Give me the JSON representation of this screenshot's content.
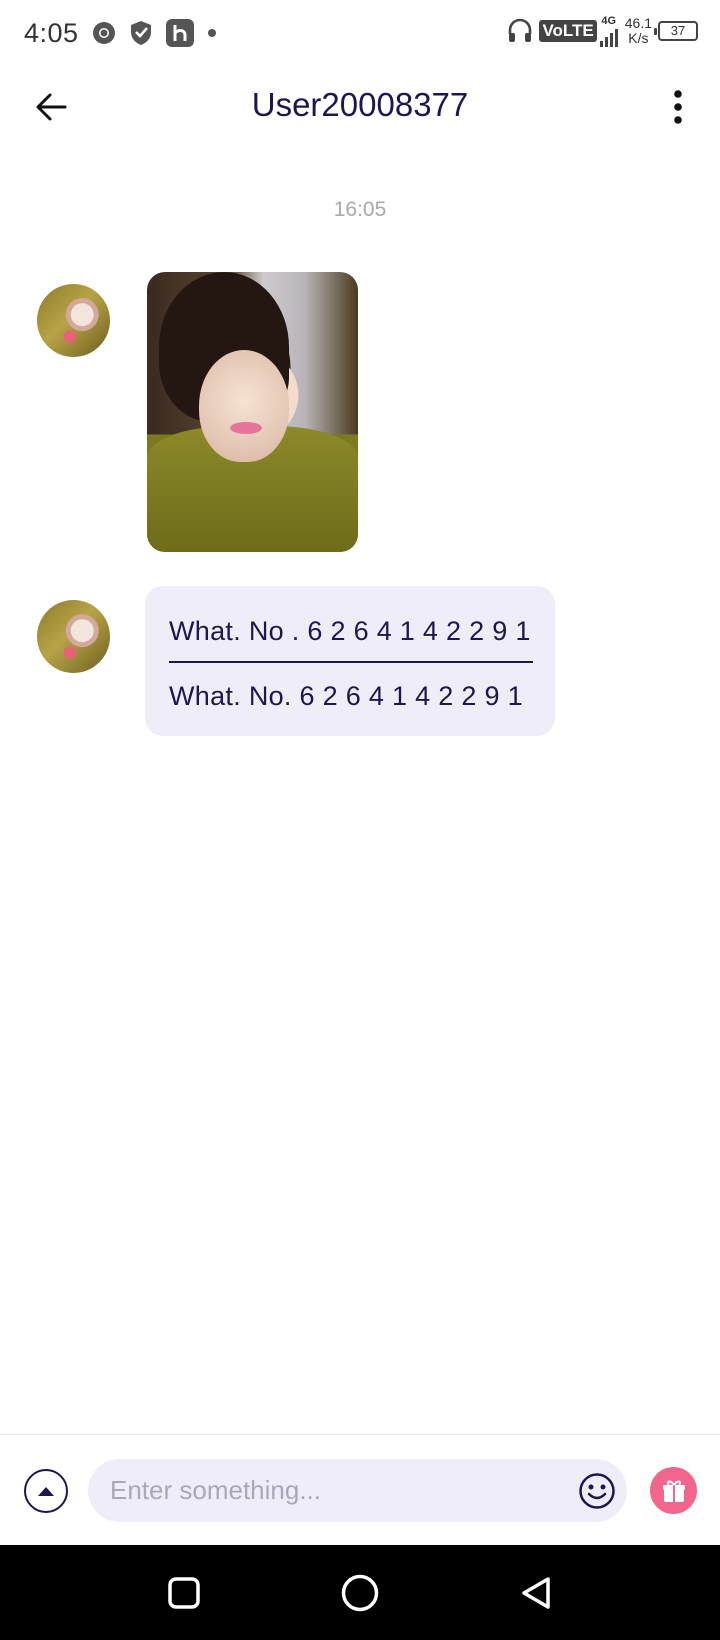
{
  "status_bar": {
    "time": "4:05",
    "network_label": "VoLTE",
    "network_gen": "4G",
    "speed_value": "46.1",
    "speed_unit": "K/s",
    "battery": "37"
  },
  "header": {
    "title": "User20008377"
  },
  "conversation": {
    "timestamp": "16:05",
    "messages": [
      {
        "type": "image"
      },
      {
        "type": "text",
        "line1": "What. No . 6 2 6 4 1 4 2 2 9 1",
        "line2": "What. No. 6 2 6 4 1 4 2 2 9 1"
      }
    ]
  },
  "input_bar": {
    "placeholder": "Enter something..."
  },
  "colors": {
    "accent": "#1f1550",
    "bubble": "#efeef8",
    "gift": "#f2658f"
  }
}
